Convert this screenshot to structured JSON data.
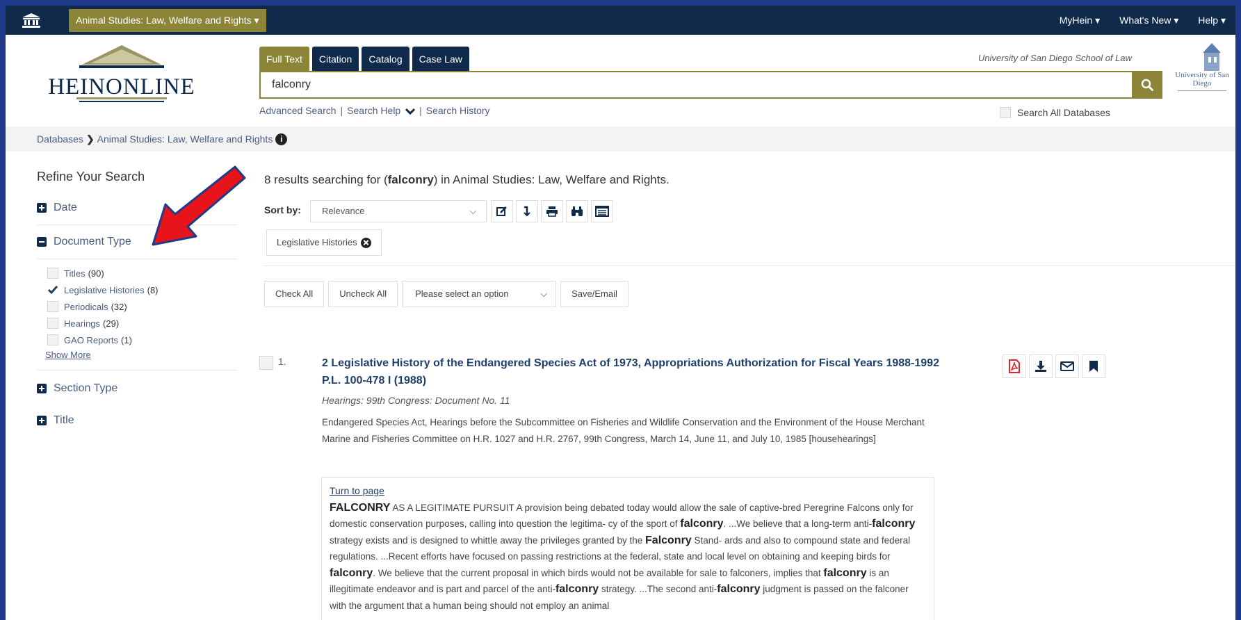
{
  "topbar": {
    "db_menu_label": "Animal Studies: Law, Welfare and Rights ▾",
    "nav": [
      {
        "label": "MyHein ▾"
      },
      {
        "label": "What's New ▾"
      },
      {
        "label": "Help ▾"
      }
    ]
  },
  "header": {
    "logo_text": "HEINONLINE",
    "tabs": [
      {
        "label": "Full Text",
        "active": true
      },
      {
        "label": "Citation",
        "active": false
      },
      {
        "label": "Catalog",
        "active": false
      },
      {
        "label": "Case Law",
        "active": false
      }
    ],
    "search_value": "falconry",
    "links": [
      "Advanced Search",
      "Search Help",
      "Search History"
    ],
    "institution": "University of San Diego School of Law",
    "search_all_label": "Search All Databases",
    "university_logo_text": "University of San Diego"
  },
  "breadcrumb": {
    "items": [
      "Databases",
      "Animal Studies: Law, Welfare and Rights"
    ]
  },
  "sidebar": {
    "title": "Refine Your Search",
    "facets": {
      "date": "Date",
      "document_type": "Document Type",
      "section_type": "Section Type",
      "title": "Title"
    },
    "document_type_options": [
      {
        "label": "Titles",
        "count": "(90)",
        "checked": false
      },
      {
        "label": "Legislative Histories",
        "count": "(8)",
        "checked": true
      },
      {
        "label": "Periodicals",
        "count": "(32)",
        "checked": false
      },
      {
        "label": "Hearings",
        "count": "(29)",
        "checked": false
      },
      {
        "label": "GAO Reports",
        "count": "(1)",
        "checked": false
      }
    ],
    "show_more": "Show More"
  },
  "results": {
    "summary_prefix": "8 results searching for (",
    "summary_term": "falconry",
    "summary_suffix": ") in Animal Studies: Law, Welfare and Rights.",
    "sort_label": "Sort by:",
    "sort_value": "Relevance",
    "filter_chip": "Legislative Histories",
    "actions": {
      "check_all": "Check All",
      "uncheck_all": "Uncheck All",
      "select_placeholder": "Please select an option",
      "save_email": "Save/Email"
    },
    "items": [
      {
        "number": "1.",
        "title": "2 Legislative History of the Endangered Species Act of 1973, Appropriations Authorization for Fiscal Years 1988-1992 P.L. 100-478 I (1988)",
        "subtitle": "Hearings: 99th Congress: Document No. 11",
        "description": "Endangered Species Act, Hearings before the Subcommittee on Fisheries and Wildlife Conservation and the Environment of the House Merchant Marine and Fisheries Committee on H.R. 1027 and H.R. 2767, 99th Congress, March 14, June 11, and July 10, 1985 [househearings]",
        "turn_to_page": "Turn to page",
        "snippet": [
          {
            "text": "FALCONRY",
            "hit": true
          },
          {
            "text": " AS A LEGITIMATE PURSUIT A provision being debated today would allow the sale of captive-bred Peregrine Falcons only for domestic conservation purposes, calling into question the legitima- cy of the sport of ",
            "hit": false
          },
          {
            "text": "falconry",
            "hit": true
          },
          {
            "text": ". ...We believe that a long-term anti-",
            "hit": false
          },
          {
            "text": "falconry",
            "hit": true
          },
          {
            "text": " strategy exists and is designed to whittle away the privileges granted by the ",
            "hit": false
          },
          {
            "text": "Falconry",
            "hit": true
          },
          {
            "text": " Stand- ards and also to compound state and federal regulations. ...Recent efforts have focused on passing restrictions at the federal, state and local level on obtaining and keeping birds for ",
            "hit": false
          },
          {
            "text": "falconry",
            "hit": true
          },
          {
            "text": ". We believe that the current proposal in which birds would not be available for sale to falconers, implies that ",
            "hit": false
          },
          {
            "text": "falconry",
            "hit": true
          },
          {
            "text": " is an illegitimate endeavor and is part and parcel of the anti-",
            "hit": false
          },
          {
            "text": "falconry",
            "hit": true
          },
          {
            "text": " strategy. ...The second anti-",
            "hit": false
          },
          {
            "text": "falconry",
            "hit": true
          },
          {
            "text": " judgment is passed on the falconer with the argument that a human being should not employ an animal",
            "hit": false
          }
        ]
      }
    ]
  },
  "colors": {
    "navy": "#0f2a4a",
    "olive": "#8c8437",
    "link": "#4a5d80",
    "arrow": "#e8141b",
    "frame": "#1f3a8a"
  }
}
